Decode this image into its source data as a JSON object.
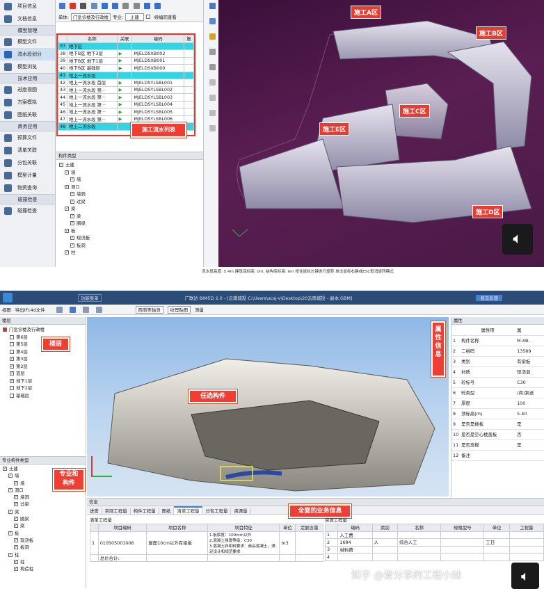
{
  "top": {
    "sidebar": {
      "items_a": [
        {
          "label": "项目信息"
        },
        {
          "label": "文档信息"
        }
      ],
      "group_model": "模型管理",
      "items_b": [
        {
          "label": "模型文件"
        },
        {
          "label": "流水段划分"
        },
        {
          "label": "模型浏览"
        }
      ],
      "group_tech": "技术应用",
      "items_c": [
        {
          "label": "进度视图"
        },
        {
          "label": "方案模拟"
        },
        {
          "label": "图纸关联"
        }
      ],
      "group_biz": "商务应用",
      "items_d": [
        {
          "label": "预算文件"
        },
        {
          "label": "清单关联"
        },
        {
          "label": "分包关联"
        },
        {
          "label": "模型计量"
        },
        {
          "label": "物资查询"
        }
      ],
      "group_check": "碰撞检查",
      "items_e": [
        {
          "label": "碰撞检查"
        }
      ]
    },
    "toolbar": {
      "unit_label": "单体:",
      "unit_value": "门急诊楼及行政楼",
      "discipline_label": "专业:",
      "discipline_value": "土建",
      "sync_label": "续编同查看"
    },
    "flow_table": {
      "headers": [
        "名称",
        "关联",
        "编码",
        "施"
      ],
      "rows": [
        {
          "no": "37",
          "name": "地下区",
          "link": "",
          "code": "",
          "hl": true
        },
        {
          "no": "38",
          "name": "地下B区 地下3层",
          "link": "▶",
          "code": "MJELDSXB002"
        },
        {
          "no": "39",
          "name": "地下B区 地下1层",
          "link": "▶",
          "code": "MJELDSXB001"
        },
        {
          "no": "40",
          "name": "地下B区 基础层",
          "link": "▶",
          "code": "MJELDSXB000"
        },
        {
          "no": "41",
          "name": "地上一流水段",
          "link": "",
          "code": "",
          "hl": true
        },
        {
          "no": "42",
          "name": "地上一流水段 首层",
          "link": "▶",
          "code": "MJELDSYLSBL001"
        },
        {
          "no": "43",
          "name": "地上一流水段 第···",
          "link": "▶",
          "code": "MJELDSYLSBL002"
        },
        {
          "no": "44",
          "name": "地上一流水段 第···",
          "link": "▶",
          "code": "MJELDSYLSBL003"
        },
        {
          "no": "45",
          "name": "地上一流水段 第···",
          "link": "▶",
          "code": "MJELDSYLSBL004"
        },
        {
          "no": "46",
          "name": "地上一流水段 第···",
          "link": "▶",
          "code": "MJELDSYLSBL005"
        },
        {
          "no": "47",
          "name": "地上一流水段 第···",
          "link": "▶",
          "code": "MJELDSYLSBL006"
        },
        {
          "no": "48",
          "name": "地上二流水段",
          "link": "",
          "code": "",
          "hl": true
        }
      ]
    },
    "flow_callout": "施工流水列表",
    "component_panel_title": "构件类型",
    "component_tree": [
      "土建",
      "墙",
      "墙",
      "洞口",
      "墙洞",
      "过梁",
      "梁",
      "梁",
      "圈梁",
      "板",
      "现浇板",
      "板洞",
      "柱"
    ],
    "zones": {
      "a": "施工A区",
      "b": "施工B区",
      "c": "施工C区",
      "d": "施工D区",
      "e": "施工E区"
    },
    "status_bar": "流水段高度: 5.4m  建筑底标高: 0m, 结构底标高: 0m          按住鼠标左键进行旋转  单击鼠标右键或ESC取消旋转模式"
  },
  "bottom": {
    "menu": "功能菜单",
    "title": "广联达 BIM5D 2.0 - [云南城投 C:\\Users\\acsj-v\\Desktop\\20云南城投 - 副本.GBM]",
    "feedback": "意见反馈",
    "toolbar": {
      "view": "视图",
      "export": "导出IFc4d文件",
      "view_mode": "西南等轴测",
      "texture": "纹理贴图",
      "measure": "测量"
    },
    "floor_panel_title": "楼层",
    "floor_root": "门急诊楼及行政楼",
    "floors": [
      {
        "label": "第6层",
        "checked": false
      },
      {
        "label": "第5层",
        "checked": false
      },
      {
        "label": "第4层",
        "checked": false
      },
      {
        "label": "第3层",
        "checked": true
      },
      {
        "label": "第2层",
        "checked": true
      },
      {
        "label": "首层",
        "checked": true
      },
      {
        "label": "地下1层",
        "checked": true
      },
      {
        "label": "地下2层",
        "checked": false
      },
      {
        "label": "基础层",
        "checked": false
      }
    ],
    "floor_callout": "楼层",
    "component_panel_title": "专业构件类型",
    "component_tree": [
      "土建",
      "墙",
      "墙",
      "洞口",
      "墙洞",
      "过梁",
      "梁",
      "圈梁",
      "梁",
      "板",
      "现浇板",
      "板洞",
      "柱",
      "柱",
      "构造柱"
    ],
    "component_callout": "专业和\n构件",
    "select_callout": "任选构件",
    "property_callout": "属\n性\n信\n息",
    "business_callout": "全面的业务信息",
    "property_panel": {
      "title": "属性",
      "header_name": "属性项",
      "header_value": "属",
      "rows": [
        {
          "no": "1",
          "name": "构件名称",
          "value": "M-XB-"
        },
        {
          "no": "2",
          "name": "二维码",
          "value": "13589"
        },
        {
          "no": "3",
          "name": "类别",
          "value": "有梁板"
        },
        {
          "no": "4",
          "name": "材质",
          "value": "现浇混"
        },
        {
          "no": "5",
          "name": "砼标号",
          "value": "C30"
        },
        {
          "no": "6",
          "name": "砼类型",
          "value": "(商)泵送"
        },
        {
          "no": "7",
          "name": "厚度",
          "value": "100"
        },
        {
          "no": "8",
          "name": "顶标高(m)",
          "value": "5.40"
        },
        {
          "no": "9",
          "name": "是否是楼板",
          "value": "是"
        },
        {
          "no": "10",
          "name": "是否是空心楼盖板",
          "value": "否"
        },
        {
          "no": "11",
          "name": "是否支模",
          "value": "是"
        },
        {
          "no": "12",
          "name": "备注",
          "value": ""
        }
      ]
    },
    "info_panel": {
      "title": "信息",
      "tabs": [
        "进度",
        "实际工程量",
        "构件工程量",
        "图纸",
        "清单工程量",
        "分包工程量",
        "资源量"
      ],
      "selected_tab": "清单工程量",
      "left_title": "清单工程量",
      "left_headers": [
        "项目编码",
        "项目名称",
        "项目特征",
        "单位",
        "定额含量"
      ],
      "left_rows": [
        {
          "no": "1",
          "code": "010505001006",
          "name": "屋面10cm以外有梁板",
          "feature": "1.板厚度：100mm以外\n2.混凝土强度等级：C30\n3.混凝土拌和料要求：商品混凝土，满足设计和规范要求",
          "unit": "m3",
          "qty": ""
        },
        {
          "no": "",
          "code": "总价合计:",
          "name": "",
          "feature": "",
          "unit": "",
          "qty": ""
        }
      ],
      "right_title": "资源工程量",
      "right_headers": [
        "编码",
        "类别",
        "名称",
        "规格型号",
        "单位",
        "工程量"
      ],
      "right_rows": [
        {
          "no": "1",
          "code": "人工费",
          "kind": "",
          "name": "",
          "spec": "",
          "unit": "",
          "qty": ""
        },
        {
          "no": "2",
          "code": "1684",
          "kind": "人",
          "name": "综合人工",
          "spec": "",
          "unit": "工日",
          "qty": ""
        },
        {
          "no": "3",
          "code": "材料费",
          "kind": "",
          "name": "",
          "spec": "",
          "unit": "",
          "qty": ""
        },
        {
          "no": "4",
          "code": "",
          "kind": "",
          "name": "",
          "spec": "",
          "unit": "",
          "qty": ""
        }
      ]
    }
  },
  "watermark": "知乎 @爱分享的工程小妹"
}
